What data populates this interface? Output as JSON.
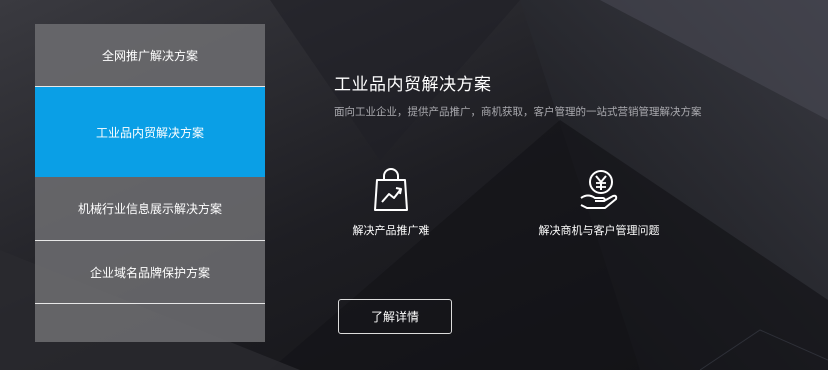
{
  "menu": {
    "items": [
      {
        "label": "全网推广解决方案",
        "active": false
      },
      {
        "label": "工业品内贸解决方案",
        "active": true
      },
      {
        "label": "机械行业信息展示解决方案",
        "active": false
      },
      {
        "label": "企业域名品牌保护方案",
        "active": false
      },
      {
        "label": "",
        "active": false
      }
    ]
  },
  "content": {
    "title": "工业品内贸解决方案",
    "subtitle": "面向工业企业，提供产品推广，商机获取，客户管理的一站式营销管理解决方案",
    "features": [
      {
        "icon": "shopping-bag-chart-icon",
        "label": "解决产品推广难"
      },
      {
        "icon": "yen-coin-hand-icon",
        "label": "解决商机与客户管理问题"
      }
    ],
    "detail_button": "了解详情"
  },
  "colors": {
    "accent": "#0a9fe6",
    "background": "#16161a",
    "menu_bg": "#6c6c70"
  }
}
